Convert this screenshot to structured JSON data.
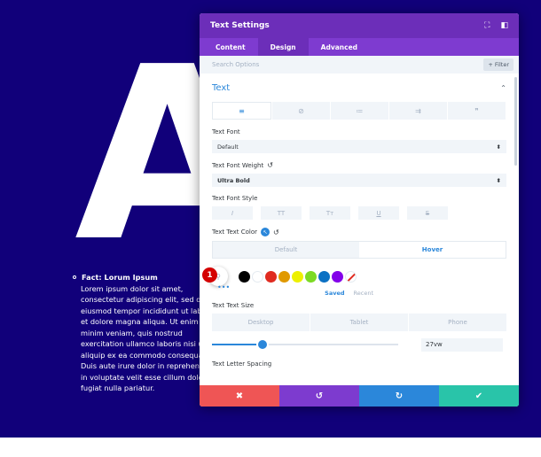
{
  "background": {
    "big_letter": "A"
  },
  "fact": {
    "title": "Fact: Lorum Ipsum",
    "body": "Lorem ipsum dolor sit amet,\nconsectetur adipiscing elit, sed do\neiusmod tempor incididunt ut lab\net dolore magna aliqua. Ut enim a\nminim veniam, quis nostrud\nexercitation ullamco laboris nisi u\naliquip ex ea commodo consequa\nDuis aute irure dolor in reprehen\nin voluptate velit esse cillum dolo\nfugiat nulla pariatur."
  },
  "panel": {
    "title": "Text Settings",
    "header_icons": {
      "expand": "⛶",
      "sidebar": "◧"
    },
    "tabs": [
      {
        "label": "Content",
        "active": false
      },
      {
        "label": "Design",
        "active": true
      },
      {
        "label": "Advanced",
        "active": false
      }
    ],
    "search": {
      "placeholder": "Search Options",
      "filter_label": "+ Filter"
    },
    "section": {
      "title": "Text",
      "chevron": "⌃"
    },
    "align_icons": [
      "≡",
      "⊘",
      "≔",
      "⇉",
      "❞"
    ],
    "font": {
      "label": "Text Font",
      "value": "Default",
      "arrow": "⬍"
    },
    "weight": {
      "label": "Text Font Weight",
      "reset": "↺",
      "value": "Ultra Bold",
      "arrow": "⬍"
    },
    "style": {
      "label": "Text Font Style",
      "buttons": [
        "I",
        "TT",
        "Tт",
        "U",
        "S"
      ]
    },
    "color": {
      "label": "Text Text Color",
      "cursor": "↖",
      "reset": "↺",
      "default_label": "Default",
      "hover_label": "Hover",
      "badge": "1",
      "picker_icon": "⚲",
      "more": "•••",
      "swatches": [
        "#000000",
        "#ffffff",
        "#e02b20",
        "#e09900",
        "#edf000",
        "#7cda24",
        "#0c71c3",
        "#8300e9"
      ],
      "saved_label": "Saved",
      "recent_label": "Recent"
    },
    "size": {
      "label": "Text Text Size",
      "devices": [
        "Desktop",
        "Tablet",
        "Phone"
      ],
      "value": "27vw",
      "slider_fraction": 0.27
    },
    "letter_spacing": {
      "label": "Text Letter Spacing"
    },
    "footer": [
      {
        "name": "discard",
        "icon": "✖",
        "color": "#ef5555"
      },
      {
        "name": "undo",
        "icon": "↺",
        "color": "#7d3bcf"
      },
      {
        "name": "redo",
        "icon": "↻",
        "color": "#2b87da"
      },
      {
        "name": "save",
        "icon": "✔",
        "color": "#29c4a9"
      }
    ]
  }
}
